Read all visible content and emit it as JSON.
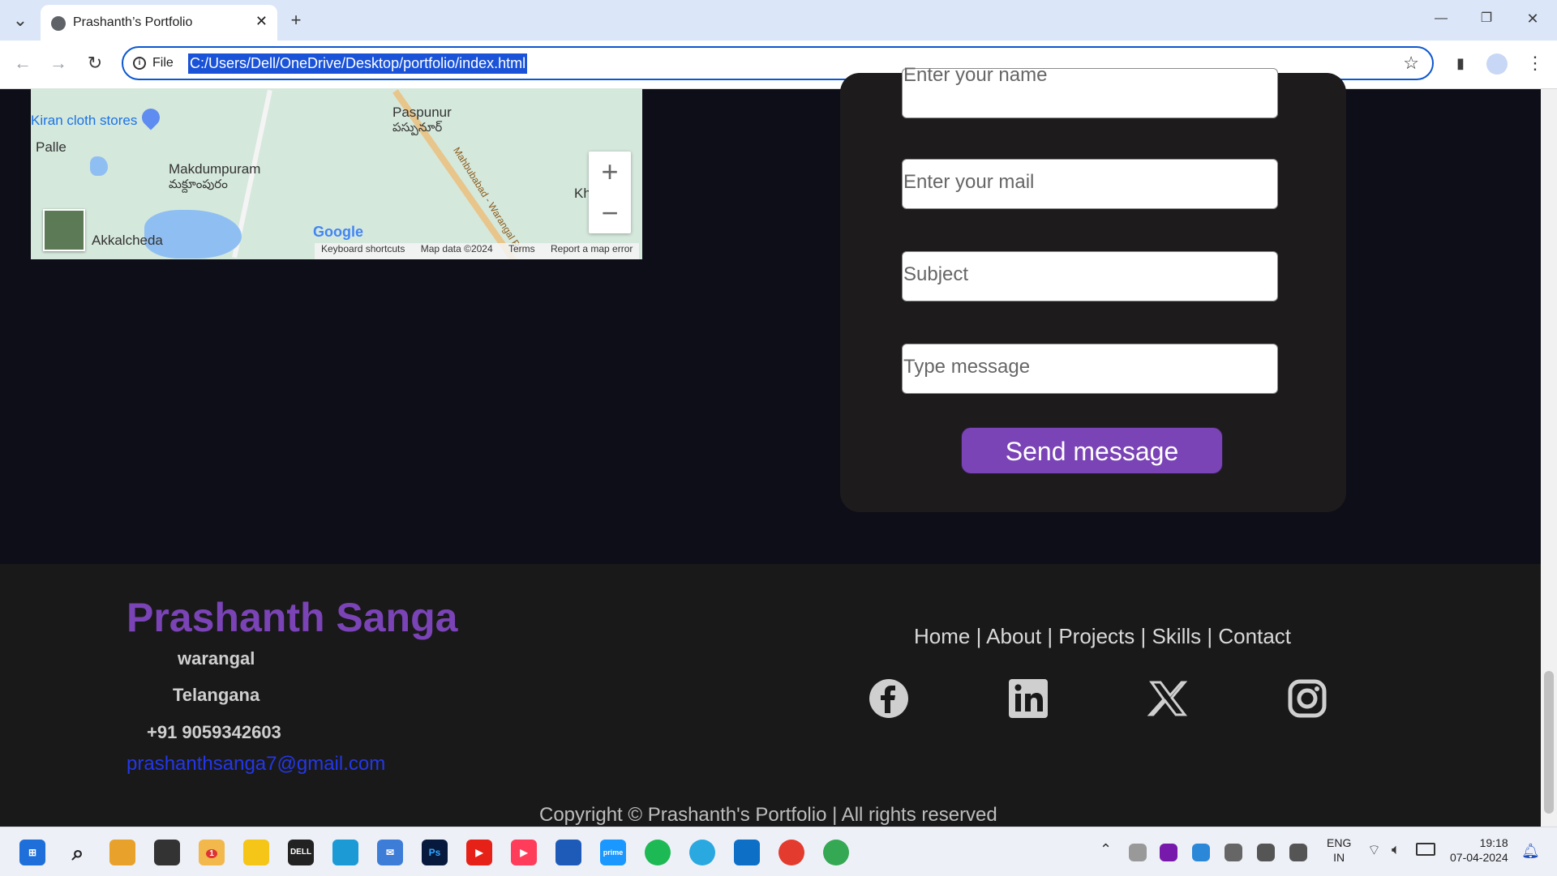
{
  "browser": {
    "tab_title": "Prashanth’s Portfolio",
    "tab_close": "✕",
    "new_tab": "+",
    "omnibox_scheme": "File",
    "url": "C:/Users/Dell/OneDrive/Desktop/portfolio/index.html",
    "window_minimize": "—",
    "window_restore": "❐",
    "window_close": "✕"
  },
  "map": {
    "labels": {
      "kiran": "Kiran cloth stores",
      "palle": "Palle",
      "makdumpuram": "Makdumpuram",
      "makdumpuram_te": "మక్దూంపురం",
      "paspunur": "Paspunur",
      "paspunur_te": "పస్పునూర్",
      "akkalcheda": "Akkalcheda",
      "road": "Mahbubabad - Warangal Rd",
      "kh": "Kh"
    },
    "zoom_in": "+",
    "zoom_out": "−",
    "google": "Google",
    "footer": {
      "shortcuts": "Keyboard shortcuts",
      "mapdata": "Map data ©2024",
      "terms": "Terms",
      "report": "Report a map error"
    }
  },
  "form": {
    "name_placeholder": "Enter your name",
    "mail_placeholder": "Enter your mail",
    "subject_placeholder": "Subject",
    "message_placeholder": "Type message",
    "send_label": "Send message"
  },
  "footer": {
    "name": "Prashanth Sanga",
    "city": "warangal",
    "state": "Telangana",
    "phone": "+91 9059342603",
    "email": "prashanthsanga7@gmail.com",
    "nav": [
      "Home",
      "About",
      "Projects",
      "Skills",
      "Contact"
    ],
    "nav_separator": "|",
    "copyright": "Copyright © Prashanth's Portfolio | All rights reserved"
  },
  "taskbar": {
    "lang_top": "ENG",
    "lang_bottom": "IN",
    "time": "19:18",
    "date": "07-04-2024",
    "notification_badge": "1"
  },
  "colors": {
    "accent": "#7a43b6",
    "page_bg": "#0e0e18",
    "card_bg": "#1d1b1c",
    "footer_bg": "#1a1919",
    "email_link": "#2437e8"
  },
  "icons": {
    "social": [
      "facebook-icon",
      "linkedin-icon",
      "x-icon",
      "instagram-icon"
    ]
  }
}
